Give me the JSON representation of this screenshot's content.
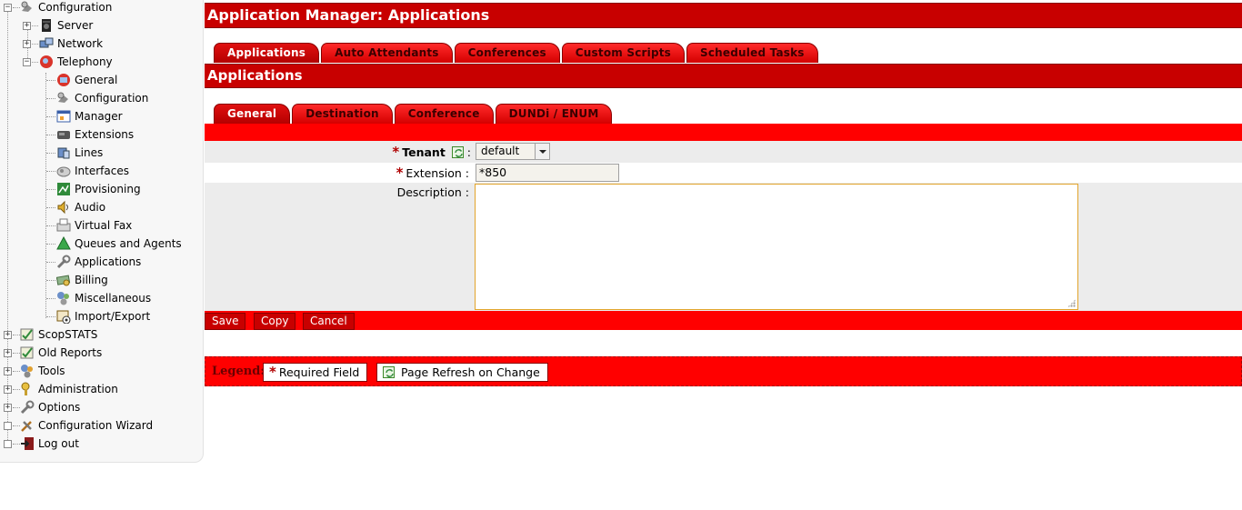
{
  "sidebar": {
    "root": {
      "label": "Configuration"
    },
    "server": {
      "label": "Server"
    },
    "network": {
      "label": "Network"
    },
    "telephony": {
      "label": "Telephony"
    },
    "telephony_items": [
      {
        "label": "General",
        "icon": "general-icon"
      },
      {
        "label": "Configuration",
        "icon": "configuration-icon"
      },
      {
        "label": "Manager",
        "icon": "manager-icon"
      },
      {
        "label": "Extensions",
        "icon": "extensions-icon"
      },
      {
        "label": "Lines",
        "icon": "lines-icon"
      },
      {
        "label": "Interfaces",
        "icon": "interfaces-icon"
      },
      {
        "label": "Provisioning",
        "icon": "provisioning-icon"
      },
      {
        "label": "Audio",
        "icon": "audio-icon"
      },
      {
        "label": "Virtual Fax",
        "icon": "fax-icon"
      },
      {
        "label": "Queues and Agents",
        "icon": "queues-icon"
      },
      {
        "label": "Applications",
        "icon": "applications-icon"
      },
      {
        "label": "Billing",
        "icon": "billing-icon"
      },
      {
        "label": "Miscellaneous",
        "icon": "miscellaneous-icon"
      },
      {
        "label": "Import/Export",
        "icon": "import-export-icon"
      }
    ],
    "bottom_items": [
      {
        "label": "ScopSTATS",
        "icon": "scopstats-icon"
      },
      {
        "label": "Old Reports",
        "icon": "reports-icon"
      },
      {
        "label": "Tools",
        "icon": "tools-icon"
      },
      {
        "label": "Administration",
        "icon": "administration-icon"
      },
      {
        "label": "Options",
        "icon": "options-icon"
      },
      {
        "label": "Configuration Wizard",
        "icon": "wizard-icon"
      },
      {
        "label": "Log out",
        "icon": "logout-icon"
      }
    ]
  },
  "header": {
    "title": "Application Manager:  Applications"
  },
  "top_tabs": [
    "Applications",
    "Auto Attendants",
    "Conferences",
    "Custom Scripts",
    "Scheduled Tasks"
  ],
  "section": {
    "title": "Applications"
  },
  "sub_tabs": [
    "General",
    "Destination",
    "Conference",
    "DUNDi / ENUM"
  ],
  "form": {
    "tenant_label": "Tenant",
    "tenant_value": "default",
    "extension_label": "Extension",
    "extension_value": "*850",
    "description_label": "Description",
    "description_value": "",
    "colon": ":"
  },
  "buttons": {
    "save": "Save",
    "copy": "Copy",
    "cancel": "Cancel"
  },
  "legend": {
    "title": "Legend:",
    "required": "Required Field",
    "refresh": "Page Refresh on Change",
    "asterisk": "*"
  },
  "colors": {
    "brand_red": "#c80000",
    "band_red": "#ff0000",
    "focus_border": "#e2a42b"
  }
}
